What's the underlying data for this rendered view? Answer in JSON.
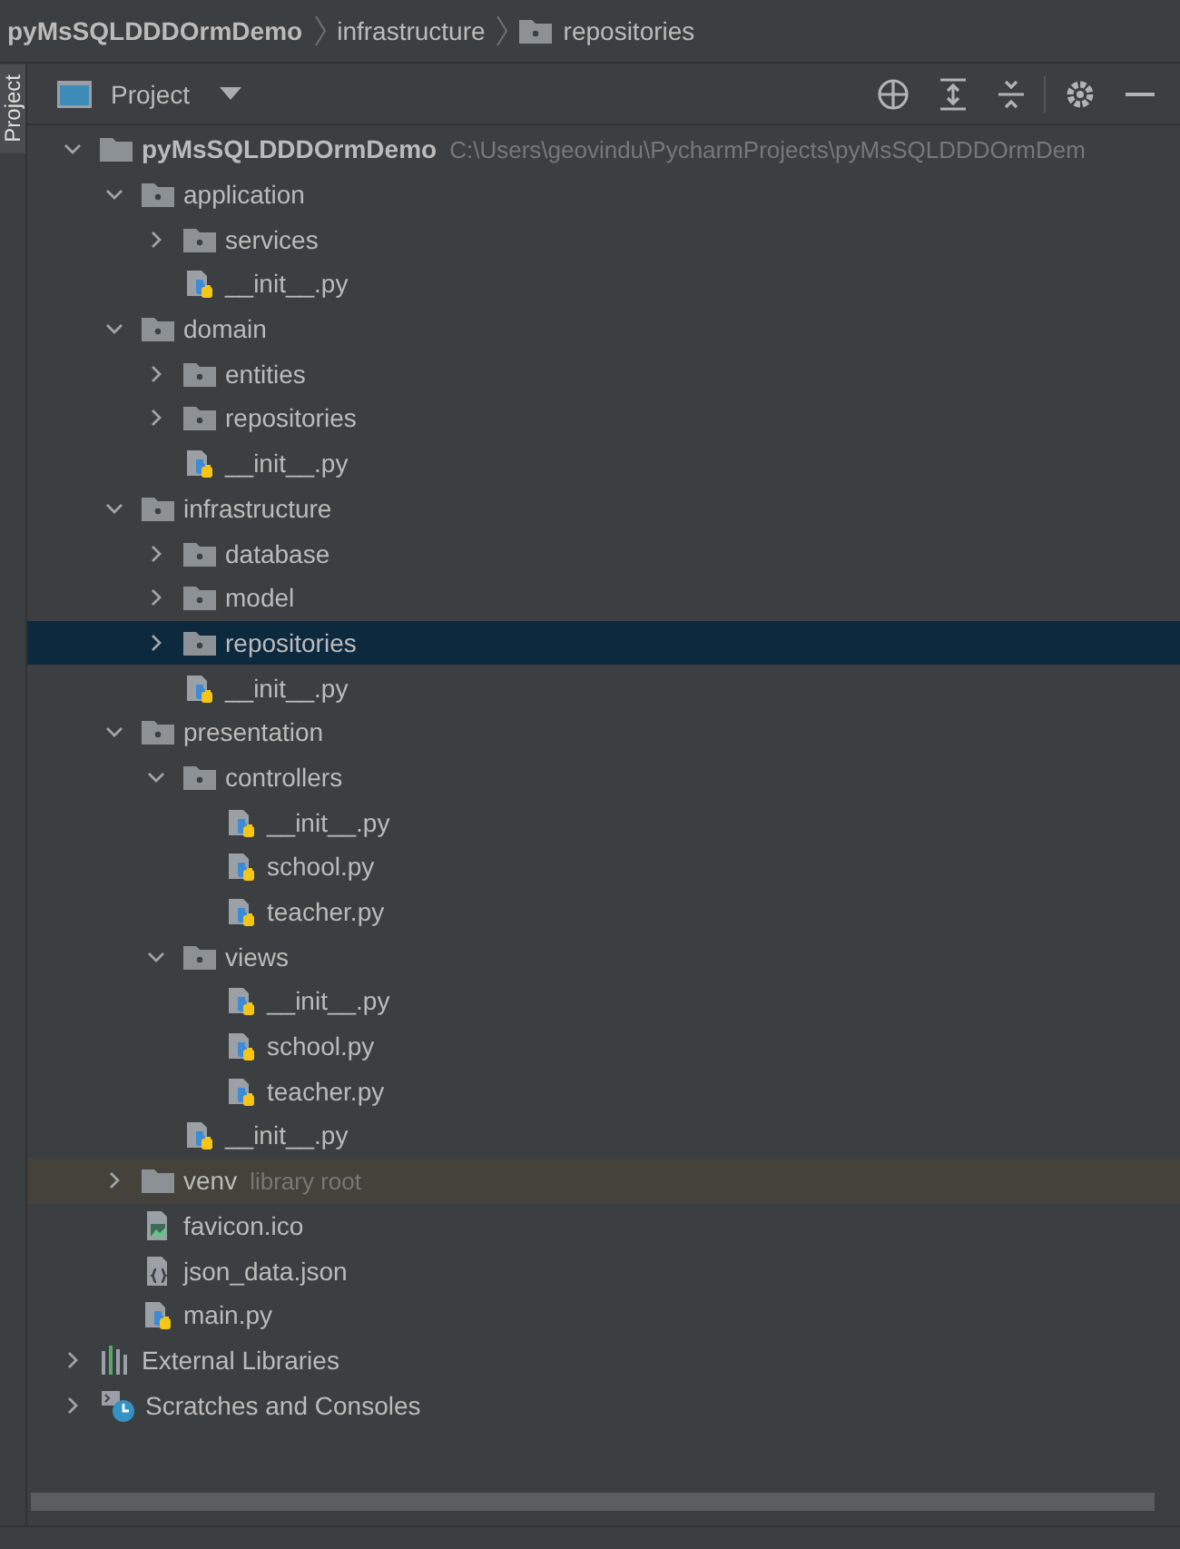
{
  "breadcrumb": [
    {
      "label": "pyMsSQLDDDOrmDemo",
      "kind": "project"
    },
    {
      "label": "infrastructure",
      "kind": "plain"
    },
    {
      "label": "repositories",
      "kind": "folder"
    }
  ],
  "side_tab": {
    "label": "Project"
  },
  "toolbar": {
    "title": "Project"
  },
  "tree": [
    {
      "label": "pyMsSQLDDDOrmDemo",
      "path": "C:\\Users\\geovindu\\PycharmProjects\\pyMsSQLDDDOrmDem",
      "kind": "root",
      "expanded": true,
      "selected": false,
      "children": [
        {
          "label": "application",
          "kind": "folder",
          "expanded": true,
          "selected": false,
          "children": [
            {
              "label": "services",
              "kind": "folder",
              "expanded": false,
              "selected": false
            },
            {
              "label": "__init__.py",
              "kind": "python",
              "selected": false
            }
          ]
        },
        {
          "label": "domain",
          "kind": "folder",
          "expanded": true,
          "selected": false,
          "children": [
            {
              "label": "entities",
              "kind": "folder",
              "expanded": false,
              "selected": false
            },
            {
              "label": "repositories",
              "kind": "folder",
              "expanded": false,
              "selected": false
            },
            {
              "label": "__init__.py",
              "kind": "python",
              "selected": false
            }
          ]
        },
        {
          "label": "infrastructure",
          "kind": "folder",
          "expanded": true,
          "selected": false,
          "children": [
            {
              "label": "database",
              "kind": "folder",
              "expanded": false,
              "selected": false
            },
            {
              "label": "model",
              "kind": "folder",
              "expanded": false,
              "selected": false
            },
            {
              "label": "repositories",
              "kind": "folder",
              "expanded": false,
              "selected": true
            },
            {
              "label": "__init__.py",
              "kind": "python",
              "selected": false
            }
          ]
        },
        {
          "label": "presentation",
          "kind": "folder",
          "expanded": true,
          "selected": false,
          "children": [
            {
              "label": "controllers",
              "kind": "folder",
              "expanded": true,
              "selected": false,
              "children": [
                {
                  "label": "__init__.py",
                  "kind": "python",
                  "selected": false
                },
                {
                  "label": "school.py",
                  "kind": "python",
                  "selected": false
                },
                {
                  "label": "teacher.py",
                  "kind": "python",
                  "selected": false
                }
              ]
            },
            {
              "label": "views",
              "kind": "folder",
              "expanded": true,
              "selected": false,
              "children": [
                {
                  "label": "__init__.py",
                  "kind": "python",
                  "selected": false
                },
                {
                  "label": "school.py",
                  "kind": "python",
                  "selected": false
                },
                {
                  "label": "teacher.py",
                  "kind": "python",
                  "selected": false
                }
              ]
            },
            {
              "label": "__init__.py",
              "kind": "python",
              "selected": false
            }
          ]
        },
        {
          "label": "venv",
          "hint": "library root",
          "kind": "library_folder",
          "expanded": false,
          "selected": false
        },
        {
          "label": "favicon.ico",
          "kind": "image",
          "selected": false
        },
        {
          "label": "json_data.json",
          "kind": "json",
          "selected": false
        },
        {
          "label": "main.py",
          "kind": "python",
          "selected": false
        }
      ]
    },
    {
      "label": "External Libraries",
      "kind": "libraries",
      "expanded": false,
      "selected": false
    },
    {
      "label": "Scratches and Consoles",
      "kind": "scratches",
      "expanded": false,
      "selected": false
    }
  ]
}
